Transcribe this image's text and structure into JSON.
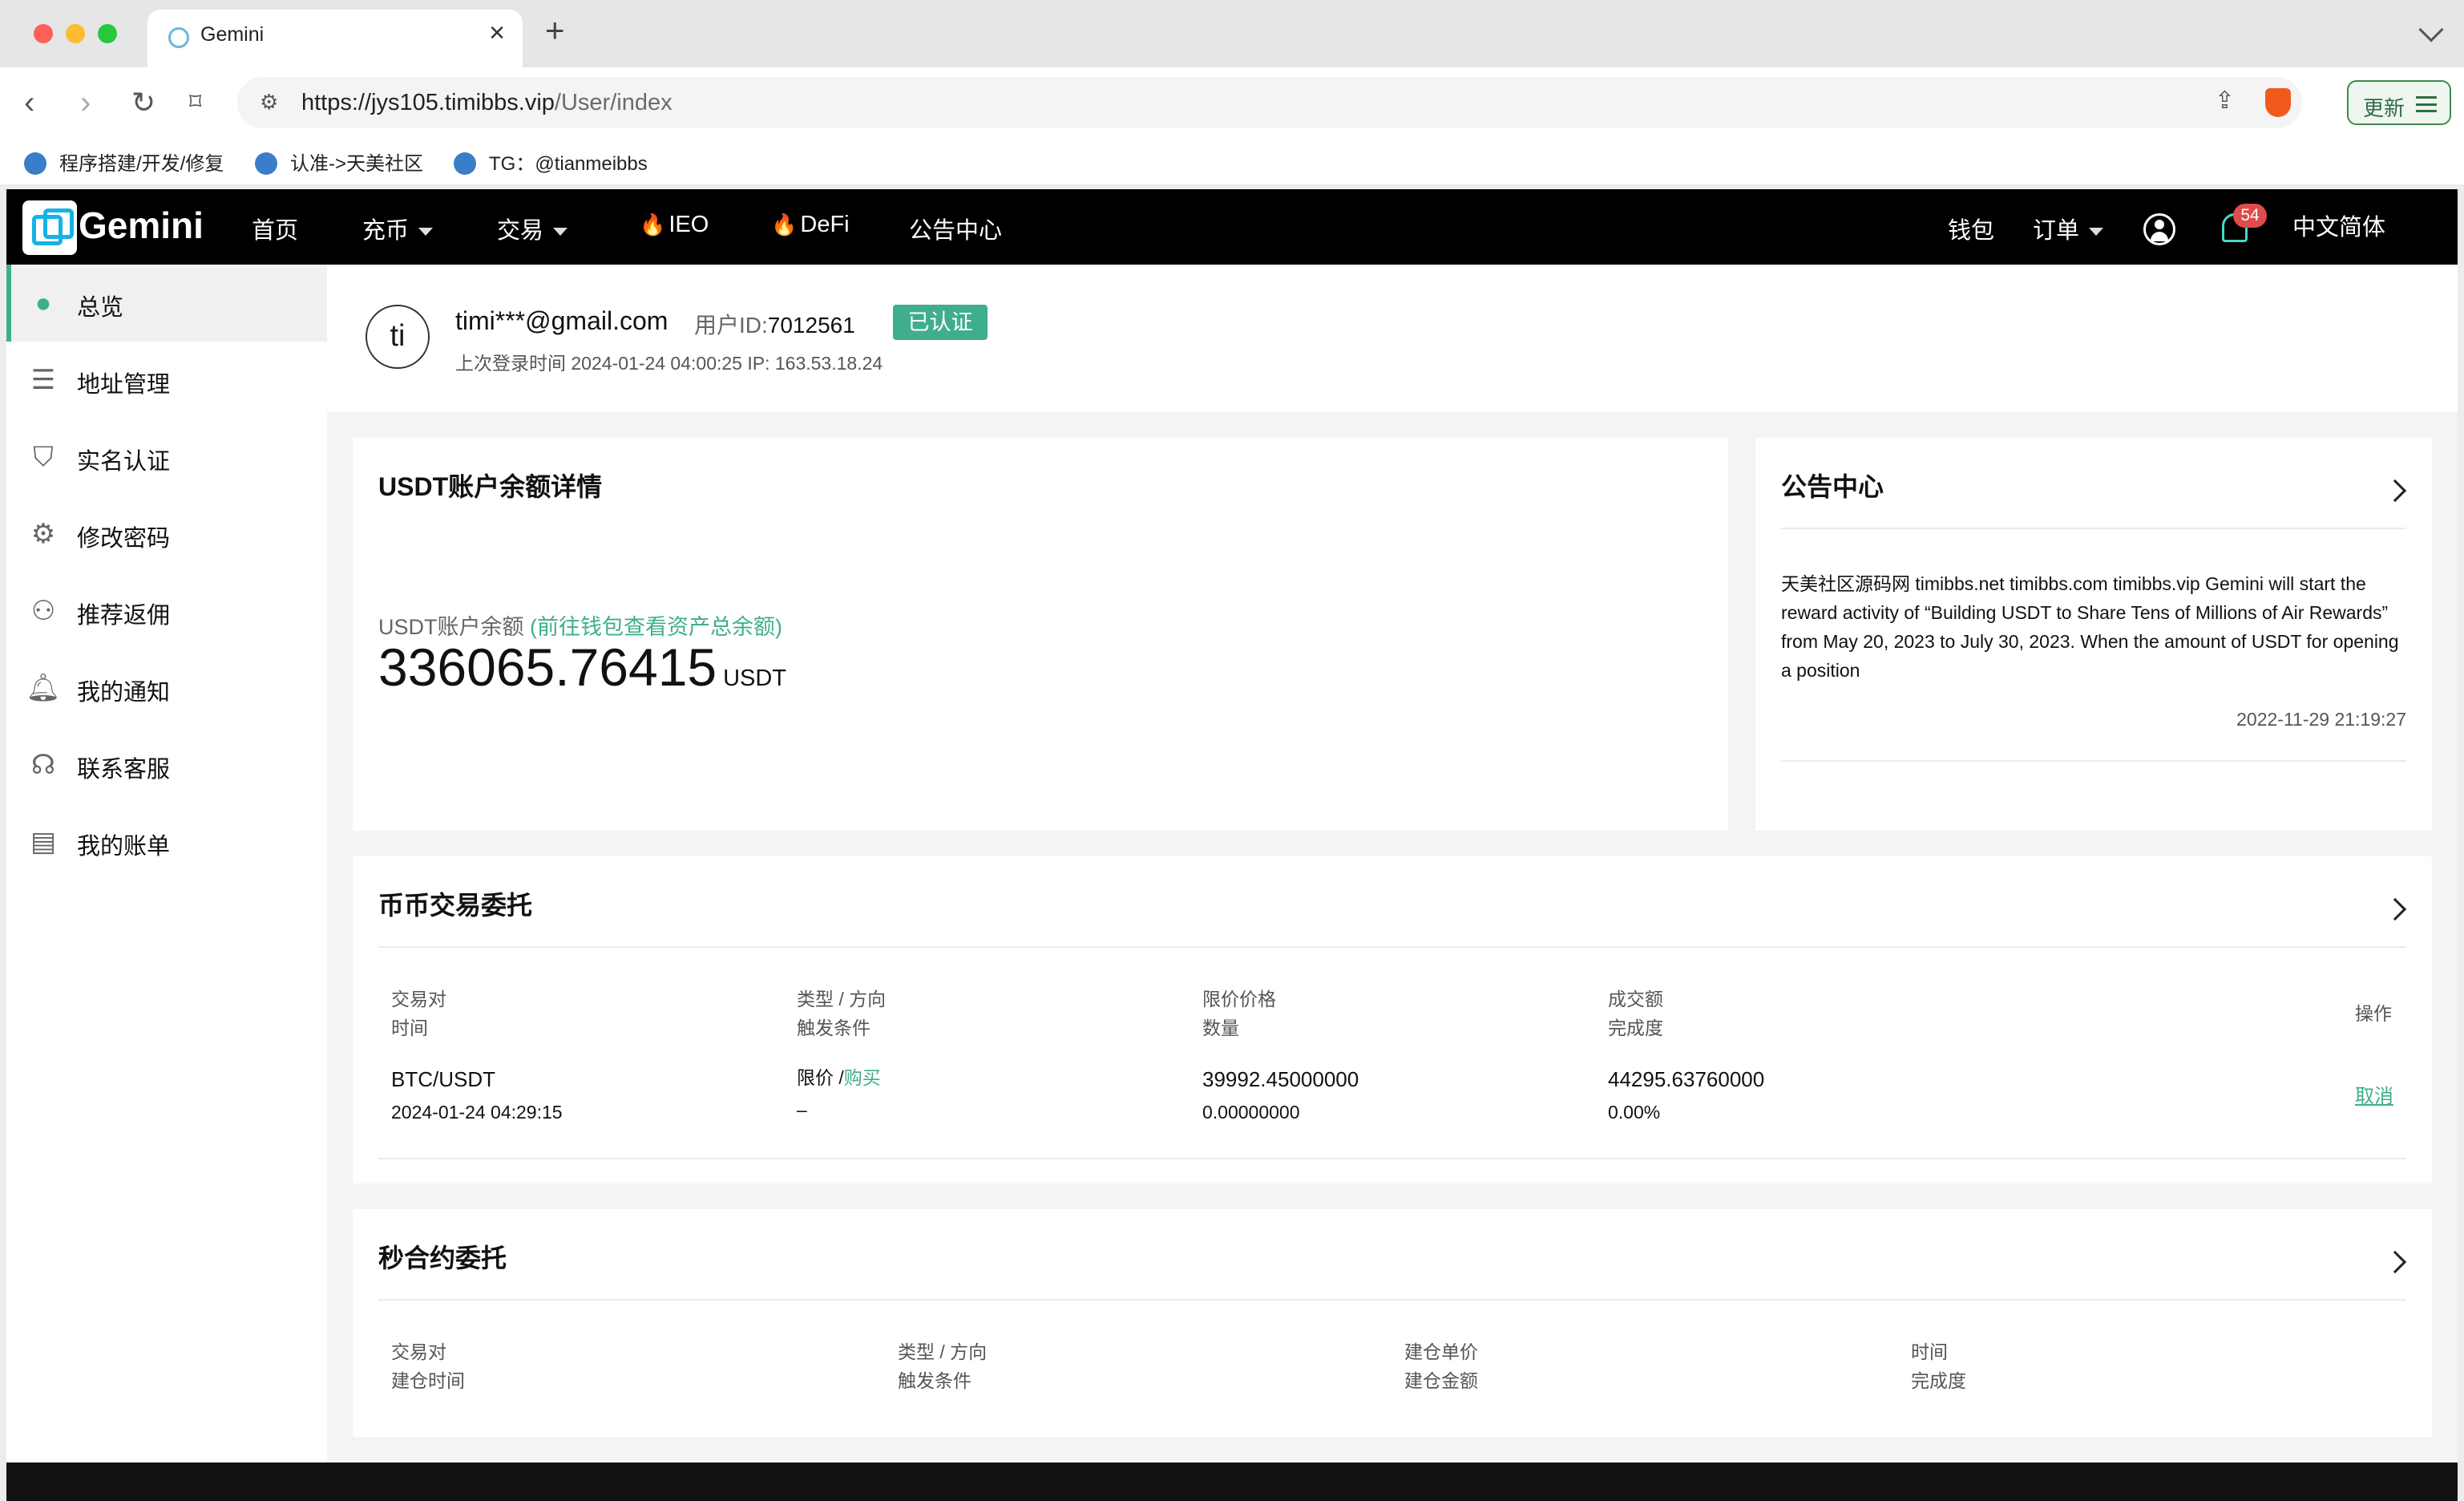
{
  "browser": {
    "tab_title": "Gemini",
    "url_host": "https://jys105.timibbs.vip",
    "url_path": "/User/index",
    "update_label": "更新",
    "bookmarks": [
      "程序搭建/开发/修复",
      "认准->天美社区",
      "TG：@tianmeibbs"
    ]
  },
  "nav": {
    "logo": "Gemini",
    "items": [
      "首页",
      "充币",
      "交易",
      "IEO",
      "DeFi",
      "公告中心"
    ],
    "right": {
      "wallet": "钱包",
      "orders": "订单",
      "badge": "54",
      "language": "中文简体"
    }
  },
  "sidebar": {
    "items": [
      {
        "label": "总览",
        "icon": "user-icon"
      },
      {
        "label": "地址管理",
        "icon": "list-icon"
      },
      {
        "label": "实名认证",
        "icon": "shield-icon"
      },
      {
        "label": "修改密码",
        "icon": "gear-icon"
      },
      {
        "label": "推荐返佣",
        "icon": "add-user-icon"
      },
      {
        "label": "我的通知",
        "icon": "bell-icon"
      },
      {
        "label": "联系客服",
        "icon": "headset-icon"
      },
      {
        "label": "我的账单",
        "icon": "bill-icon"
      }
    ]
  },
  "profile": {
    "avatar": "ti",
    "email": "timi***@gmail.com",
    "uid_label": "用户ID:",
    "uid": "7012561",
    "status": "已认证",
    "last_login": "上次登录时间 2024-01-24 04:00:25   IP: 163.53.18.24"
  },
  "balance_card": {
    "title": "USDT账户余额详情",
    "label": "USDT账户余额 ",
    "link": "(前往钱包查看资产总余额)",
    "value": "336065.76415",
    "unit": "USDT"
  },
  "announcement": {
    "title": "公告中心",
    "text": "天美社区源码网 timibbs.net timibbs.com timibbs.vip Gemini will start the reward activity of “Building USDT to Share Tens of Millions of Air Rewards” from May 20, 2023 to July 30, 2023. When the amount of USDT for opening a position",
    "date": "2022-11-29 21:19:27"
  },
  "spot_orders": {
    "title": "币币交易委托",
    "headers": [
      [
        "交易对",
        "时间"
      ],
      [
        "类型 / 方向",
        "触发条件"
      ],
      [
        "限价价格",
        "数量"
      ],
      [
        "成交额",
        "完成度"
      ]
    ],
    "action_header": "操作",
    "row": {
      "pair": "BTC/USDT",
      "time": "2024-01-24 04:29:15",
      "type": "限价 /",
      "side": "购买",
      "trigger": "–",
      "price": "39992.45000000",
      "qty": "0.00000000",
      "amount": "44295.63760000",
      "progress": "0.00%",
      "action": "取消"
    }
  },
  "contract_orders": {
    "title": "秒合约委托",
    "headers": [
      [
        "交易对",
        "建仓时间"
      ],
      [
        "类型 / 方向",
        "触发条件"
      ],
      [
        "建仓单价",
        "建仓金额"
      ],
      [
        "时间",
        "完成度"
      ]
    ]
  },
  "colors": {
    "accent": "#3fae8c",
    "nav_bg": "#000000",
    "badge": "#e04b4b"
  }
}
